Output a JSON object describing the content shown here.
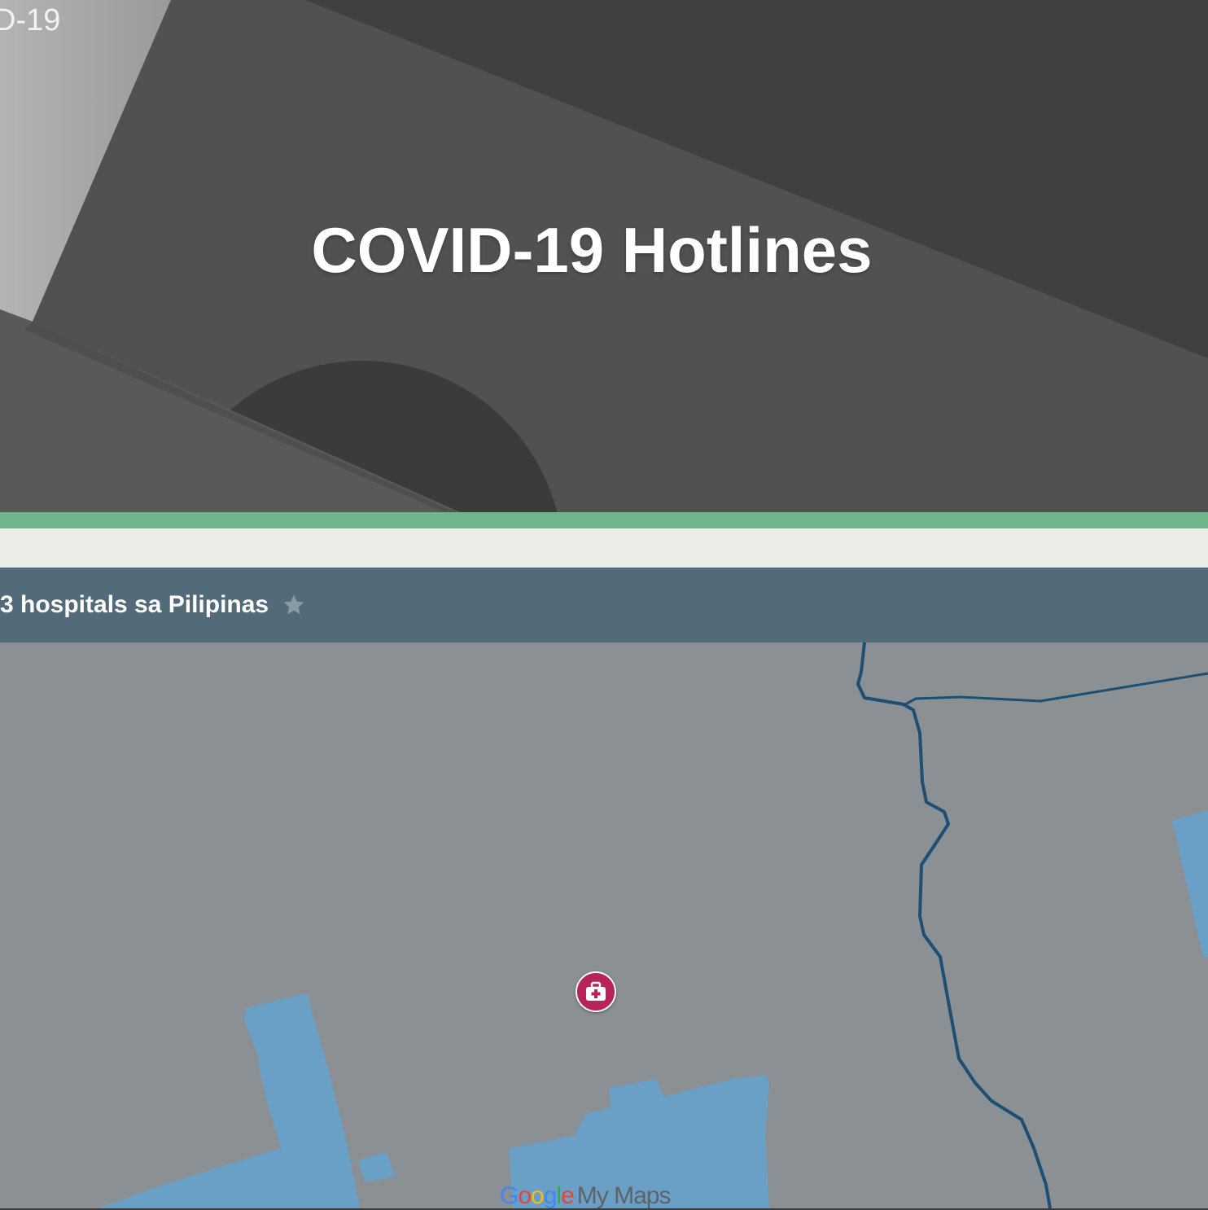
{
  "hero": {
    "corner_text": "D-19",
    "title": "COVID-19 Hotlines"
  },
  "map": {
    "header_title": "3 hospitals sa Pilipinas",
    "star_icon": "star-icon",
    "marker_icon": "hospital-medkit-icon",
    "attribution": {
      "google_letters": [
        "G",
        "o",
        "o",
        "g",
        "l",
        "e"
      ],
      "product": "My Maps"
    }
  },
  "colors": {
    "hero_background": "#444444",
    "accent_green": "#6fb58b",
    "light_band": "#ebebe7",
    "map_header": "#536a79",
    "map_land": "#8b9094",
    "map_water": "#6aa0c6",
    "map_river": "#1f4e73",
    "marker": "#b6245a"
  }
}
